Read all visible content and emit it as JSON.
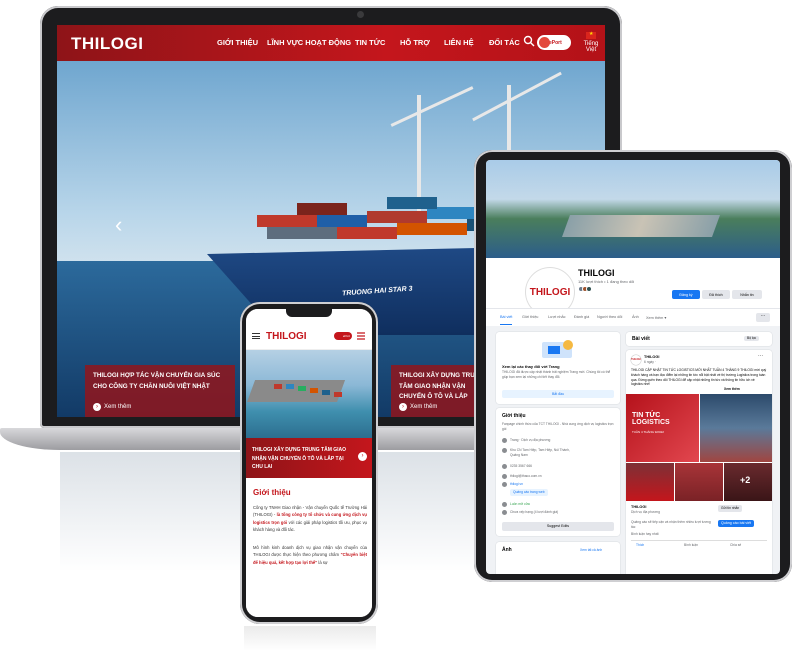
{
  "laptop": {
    "logo": "THILOGI",
    "nav": [
      "GIỚI THIỆU",
      "LĨNH VỰC HOẠT ĐỘNG",
      "TIN TỨC",
      "HỖ TRỢ",
      "LIÊN HỆ",
      "ĐỐI TÁC"
    ],
    "eport_label": "ePort",
    "language": "Tiếng Việt",
    "ship_name": "TRUONG HAI STAR 3",
    "news": [
      {
        "title": "THILOGI HỢP TÁC VẬN CHUYỂN GIA SÚC CHO CÔNG TY CHĂN NUÔI VIỆT NHẬT",
        "more": "Xem thêm"
      },
      {
        "title": "THILOGI XÂY DỰNG TRUNG TÂM GIAO NHẬN VẬN CHUYỂN Ô TÔ VÀ LẮP",
        "more": "Xem thêm"
      }
    ]
  },
  "tablet": {
    "page_name": "THILOGI",
    "likes": "11K lượt thích • 1 đang theo dõi",
    "logo": "THILOGI",
    "buttons": {
      "register": "Đăng ký",
      "liked": "Đã thích",
      "message": "Nhắn tin"
    },
    "tabs": [
      "Bài viết",
      "Giới thiệu",
      "Lượt nhắc",
      "Đánh giá",
      "Người theo dõi",
      "Ảnh",
      "Xem thêm ▾"
    ],
    "suggest": {
      "title": "Xem lại các thay đổi với Trang",
      "text": "THILOGI đã được cập nhật thành trải nghiệm Trang mới. Chúng tôi có thể giúp bạn xem lại những chi tiết thay đổi.",
      "link": "Bắt đầu"
    },
    "about": {
      "title": "Giới thiệu",
      "desc": "Fanpage chính thức của TCT THILOGI - Nhà cung ứng dịch vụ logistics trọn gói",
      "items": [
        "Trang · Dịch vụ địa phương",
        "Khu CN Tam Hiệp, Tam Hiệp, Núi Thành, Quảng Nam",
        "0235 3567 666",
        "thilogi@thaco.com.vn",
        "thilogi.vn",
        "Quảng cáo trang web",
        "Luôn mở cửa",
        "Chưa xếp hạng (4 lượt đánh giá)"
      ],
      "suggest_btn": "Suggest Edits"
    },
    "photos": {
      "title": "Ảnh",
      "link": "Xem tất cả ảnh"
    },
    "posts": {
      "title": "Bài viết",
      "filter": "Bộ lọc",
      "author": "THILOGI",
      "time": "6 ngày · ",
      "text": "THILOGI CẬP NHẬT TIN TỨC LOGISTICS MỚI NHẤT TUẦN 4 THÁNG 9 THILOGI mời quý khách hàng và bạn đọc điểm lại những tin tức nổi bật nhất về thị trường Logistics trong tuần qua. Đừng quên theo dõi THILOGI để cập nhật những tin tức và thông tin hữu ích về logistics nhé!",
      "see_more": "Xem thêm",
      "banner": "TIN TỨC LOGISTICS",
      "banner_sub": "TUẦN 4 THÁNG 9/2022",
      "tile_count": "+2",
      "page_name": "THILOGI",
      "page_type": "Dịch vụ địa phương",
      "send_msg": "Gửi tin nhắn",
      "promo": "Quảng cáo sẽ tiếp cận và nhận thêm nhiều lượt tương tác",
      "promo_btn": "Quảng cáo bài viết",
      "reach": "Bình luận hay nhất",
      "actions": [
        "Thích",
        "Bình luận",
        "Chia sẻ"
      ]
    }
  },
  "phone": {
    "logo": "THILOGI",
    "eport": "ePort",
    "red_title": "THILOGI XÂY DỰNG TRUNG TÂM GIAO NHẬN VẬN CHUYỂN Ô TÔ VÀ LẮP TẠI CHU LAI",
    "heading": "Giới thiệu",
    "p1_a": "Công ty TNHH Giao nhận - Vận chuyển Quốc tế Trường Hải (THILOGI) - ",
    "p1_b": "là tổng công ty tổ chức và cung ứng dịch vụ logistics trọn gói",
    "p1_c": " với các giải pháp logistics tối ưu, phục vụ khách hàng và đối tác.",
    "p2_a": "Mô hình kinh doanh dịch vụ giao nhận vận chuyển của THILOGI được thực hiện theo phương châm ",
    "p2_b": "\"Chuyên biệt để hiệu quả, kết hợp tạo lợi thế\"",
    "p2_c": " là sự"
  },
  "colors": {
    "brand_red": "#c4161c",
    "facebook_blue": "#1877f2"
  }
}
